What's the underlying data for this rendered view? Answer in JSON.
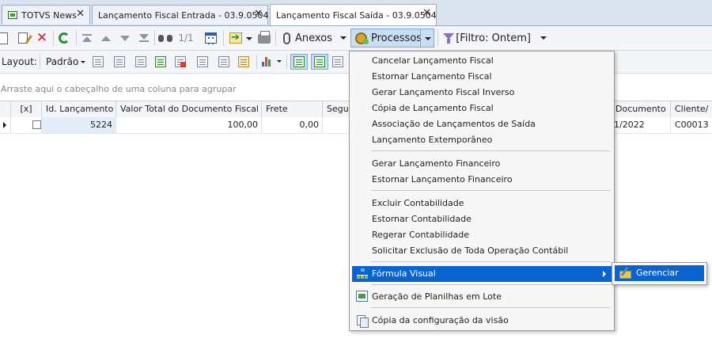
{
  "tabs": [
    {
      "label": "TOTVS News",
      "icon": "totvs-news-icon",
      "close": "✕"
    },
    {
      "label": "Lançamento Fiscal Entrada - 03.9.0504",
      "close": "✕"
    },
    {
      "label": "Lançamento Fiscal Saída - 03.9.0504",
      "close": "✕",
      "active": true
    }
  ],
  "toolbar": {
    "pager": "1/1",
    "anexos_label": "Anexos",
    "processos_label": "Processos",
    "filter_label": "[Filtro: Ontem]"
  },
  "toolbar2": {
    "layout_label": "Layout:",
    "padrao_label": "Padrão"
  },
  "grid": {
    "group_hint": "Arraste aqui o cabeçalho de uma coluna para agrupar",
    "columns": {
      "check": "[x]",
      "id": "Id. Lançamento",
      "valor_total": "Valor Total do Documento Fiscal",
      "frete": "Frete",
      "seguro": "Seguro",
      "documento": "Documento",
      "cliente": "Cliente/ Fo"
    },
    "rows": [
      {
        "id": "5224",
        "valor_total": "100,00",
        "frete": "0,00",
        "data": "1/2022",
        "cliente": "C00013"
      }
    ]
  },
  "menu": {
    "items": [
      "Cancelar Lançamento Fiscal",
      "Estornar Lançamento Fiscal",
      "Gerar Lançamento Fiscal Inverso",
      "Cópia de Lançamento Fiscal",
      "Associação de Lançamentos de Saída",
      "Lançamento Extemporâneo",
      "Gerar Lançamento Financeiro",
      "Estornar Lançamento Financeiro",
      "Excluir Contabilidade",
      "Estornar Contabilidade",
      "Regerar Contabilidade",
      "Solicitar Exclusão de Toda Operação Contábil",
      "Fórmula Visual",
      "Geração de Planilhas em Lote",
      "Cópia da configuração da visão"
    ],
    "submenu": {
      "label": "Gerenciar"
    }
  },
  "colors": {
    "highlight": "#0a64cf",
    "tab_bar": "#dbe3ee",
    "toolbar": "#f3f5f9",
    "delete_red": "#d21f1f",
    "refresh_green": "#2e8b2e"
  }
}
